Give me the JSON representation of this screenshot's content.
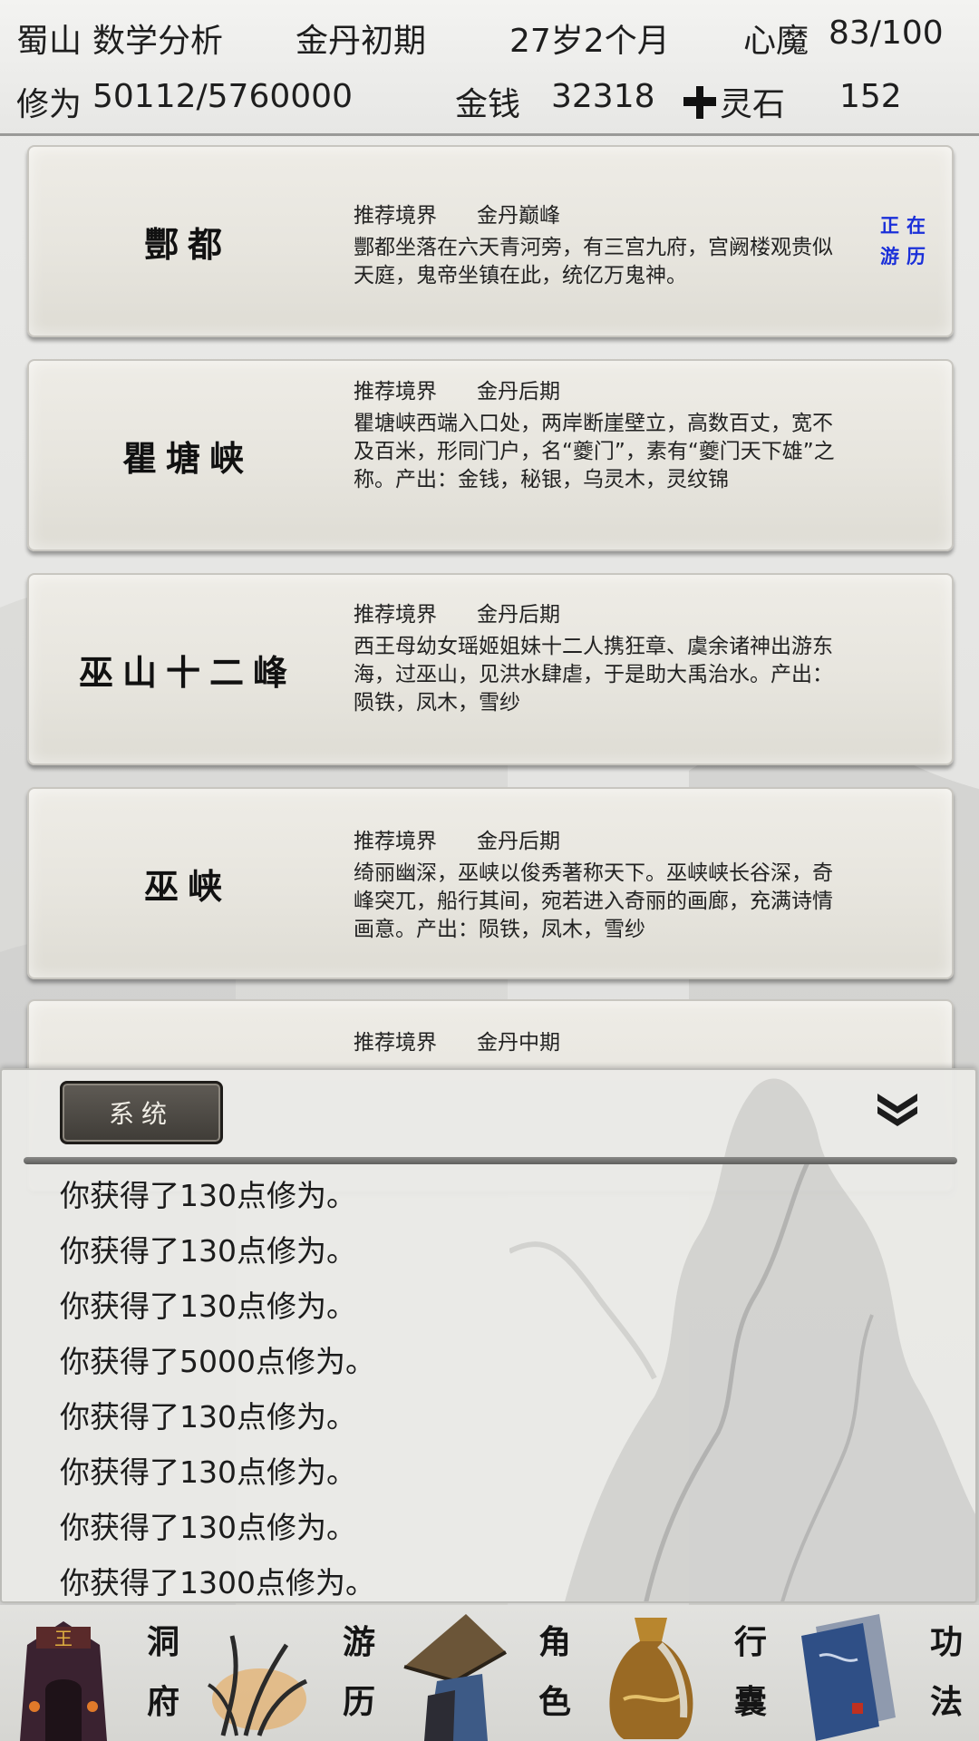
{
  "header": {
    "sect": "蜀山",
    "player_name": "数学分析",
    "realm": "金丹初期",
    "age": "27岁2个月",
    "heart_demon_label": "心魔",
    "heart_demon_value": "83/100",
    "cultivation_label": "修为",
    "cultivation_value": "50112/5760000",
    "money_label": "金钱",
    "money_value": "32318",
    "spirit_stone_label": "灵石",
    "spirit_stone_value": "152"
  },
  "locations": [
    {
      "name": "酆都",
      "realm_label": "推荐境界",
      "realm_value": "金丹巅峰",
      "description": "酆都坐落在六天青河旁，有三宫九府，宫阙楼观贵似天庭，鬼帝坐镇在此，统亿万鬼神。",
      "status": "正在游历"
    },
    {
      "name": "瞿塘峡",
      "realm_label": "推荐境界",
      "realm_value": "金丹后期",
      "description": "瞿塘峡西端入口处，两岸断崖壁立，高数百丈，宽不及百米，形同门户，名“夔门”，素有“夔门天下雄”之称。产出：金钱，秘银，乌灵木，灵纹锦"
    },
    {
      "name": "巫山十二峰",
      "realm_label": "推荐境界",
      "realm_value": "金丹后期",
      "description": "西王母幼女瑶姬姐妹十二人携狂章、虞余诸神出游东海，过巫山，见洪水肆虐，于是助大禹治水。产出：陨铁，凤木，雪纱"
    },
    {
      "name": "巫峡",
      "realm_label": "推荐境界",
      "realm_value": "金丹后期",
      "description": "绮丽幽深，巫峡以俊秀著称天下。巫峡峡长谷深，奇峰突兀，船行其间，宛若进入奇丽的画廊，充满诗情画意。产出：陨铁，凤木，雪纱"
    },
    {
      "realm_label": "推荐境界",
      "realm_value": "金丹中期"
    }
  ],
  "log": {
    "tab_label": "系统",
    "lines": [
      "你获得了130点修为。",
      "你获得了130点修为。",
      "你获得了130点修为。",
      "你获得了5000点修为。",
      "你获得了130点修为。",
      "你获得了130点修为。",
      "你获得了130点修为。",
      "你获得了1300点修为。"
    ]
  },
  "nav": [
    {
      "label_top": "洞",
      "label_bottom": "府",
      "icon": "cave-mansion-icon"
    },
    {
      "label_top": "游",
      "label_bottom": "历",
      "icon": "travel-grass-icon"
    },
    {
      "label_top": "角",
      "label_bottom": "色",
      "icon": "character-hat-icon"
    },
    {
      "label_top": "行",
      "label_bottom": "囊",
      "icon": "inventory-bag-icon"
    },
    {
      "label_top": "功",
      "label_bottom": "法",
      "icon": "technique-books-icon"
    }
  ],
  "colors": {
    "status_text": "#1a2fd9",
    "tab_bg": "#4a4640",
    "card_bg": "#e9e7e0"
  }
}
